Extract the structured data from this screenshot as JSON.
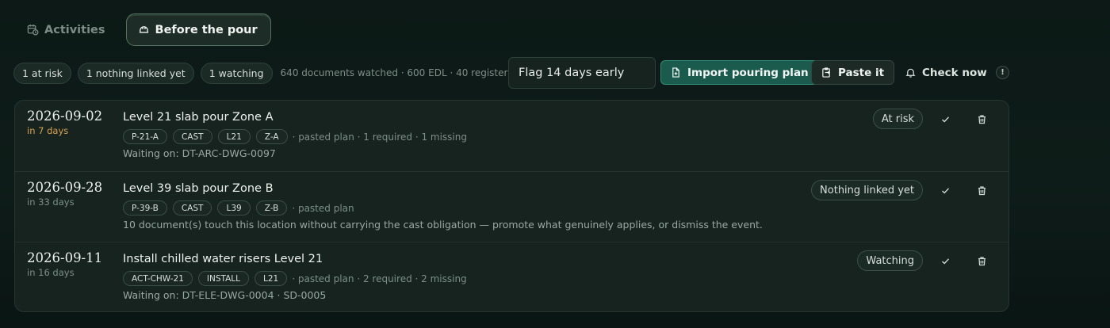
{
  "tabs": [
    {
      "label": "Activities",
      "icon": "calendar-clock-icon",
      "active": false
    },
    {
      "label": "Before the pour",
      "icon": "hard-hat-icon",
      "active": true
    }
  ],
  "toolbar": {
    "pills": [
      "1 at risk",
      "1 nothing linked yet",
      "1 watching"
    ],
    "summary": "640 documents watched · 600 EDL · 40 register",
    "flag_value": "Flag 14 days early",
    "import_label": "Import pouring plan",
    "paste_label": "Paste it",
    "check_label": "Check now",
    "info": "!"
  },
  "events": [
    {
      "date": "2026-09-02",
      "relative": "in 7 days",
      "title": "Level 21 slab pour Zone A",
      "tags": [
        "P-21-A",
        "CAST",
        "L21",
        "Z-A"
      ],
      "meta": "· pasted plan  · 1 required · 1 missing",
      "note": "Waiting on: DT-ARC-DWG-0097",
      "status": "At risk"
    },
    {
      "date": "2026-09-28",
      "relative": "in 33 days",
      "title": "Level 39 slab pour Zone B",
      "tags": [
        "P-39-B",
        "CAST",
        "L39",
        "Z-B"
      ],
      "meta": "· pasted plan",
      "note": "10 document(s) touch this location without carrying the cast obligation — promote what genuinely applies, or dismiss the event.",
      "status": "Nothing linked yet"
    },
    {
      "date": "2026-09-11",
      "relative": "in 16 days",
      "title": "Install chilled water risers Level 21",
      "tags": [
        "ACT-CHW-21",
        "INSTALL",
        "L21"
      ],
      "meta": "· pasted plan  · 2 required · 2 missing",
      "note": "Waiting on: DT-ELE-DWG-0004 · SD-0005",
      "status": "Watching"
    }
  ],
  "colors": {
    "accent": "#1b5b4e",
    "warning": "#d7a14f",
    "background": "#0c1916"
  }
}
